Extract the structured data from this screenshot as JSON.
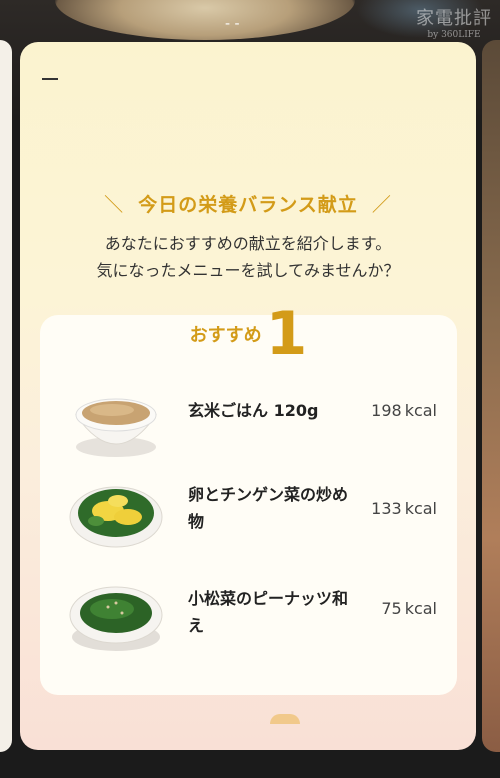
{
  "watermark": {
    "brand": "家電批評",
    "sub": "by 360LIFE"
  },
  "top_indicator": "- -",
  "card": {
    "heading": "今日の栄養バランス献立",
    "heading_left": "＼",
    "heading_right": "／",
    "intro_line1": "あなたにおすすめの献立を紹介します。",
    "intro_line2": "気になったメニューを試してみませんか？",
    "recommend": {
      "label": "おすすめ",
      "number": "1",
      "items": [
        {
          "name": "玄米ごはん 120g",
          "kcal": "198",
          "unit": "kcal",
          "dish": "brown-rice-bowl"
        },
        {
          "name": "卵とチンゲン菜の炒め物",
          "kcal": "133",
          "unit": "kcal",
          "dish": "egg-bokchoy-stirfry-plate"
        },
        {
          "name": "小松菜のピーナッツ和え",
          "kcal": "75",
          "unit": "kcal",
          "dish": "komatsuna-peanut-dish"
        }
      ]
    }
  },
  "colors": {
    "accent": "#d39b18",
    "card_top": "#fbf3cf",
    "card_bottom": "#f9e0d6"
  }
}
